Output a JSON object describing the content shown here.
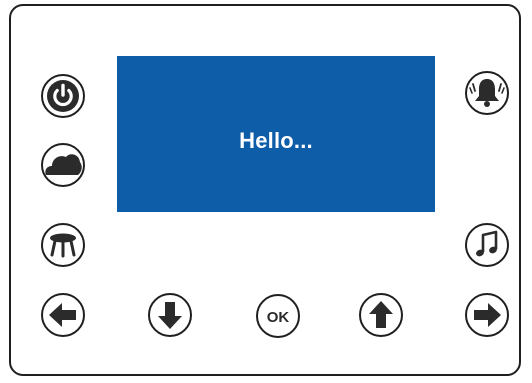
{
  "display": {
    "text": "Hello...",
    "background_color": "#0e5da8",
    "text_color": "#ffffff"
  },
  "buttons": {
    "power": {
      "icon": "power-icon"
    },
    "cloud": {
      "icon": "cloud-icon"
    },
    "stool": {
      "icon": "stool-icon"
    },
    "bell": {
      "icon": "bell-icon"
    },
    "music": {
      "icon": "music-note-icon"
    },
    "left": {
      "icon": "arrow-left-icon"
    },
    "down": {
      "icon": "arrow-down-icon"
    },
    "ok": {
      "label": "OK"
    },
    "up": {
      "icon": "arrow-up-icon"
    },
    "right": {
      "icon": "arrow-right-icon"
    }
  },
  "colors": {
    "icon_dark": "#2b2b2b",
    "outline": "#1f1f1f"
  }
}
